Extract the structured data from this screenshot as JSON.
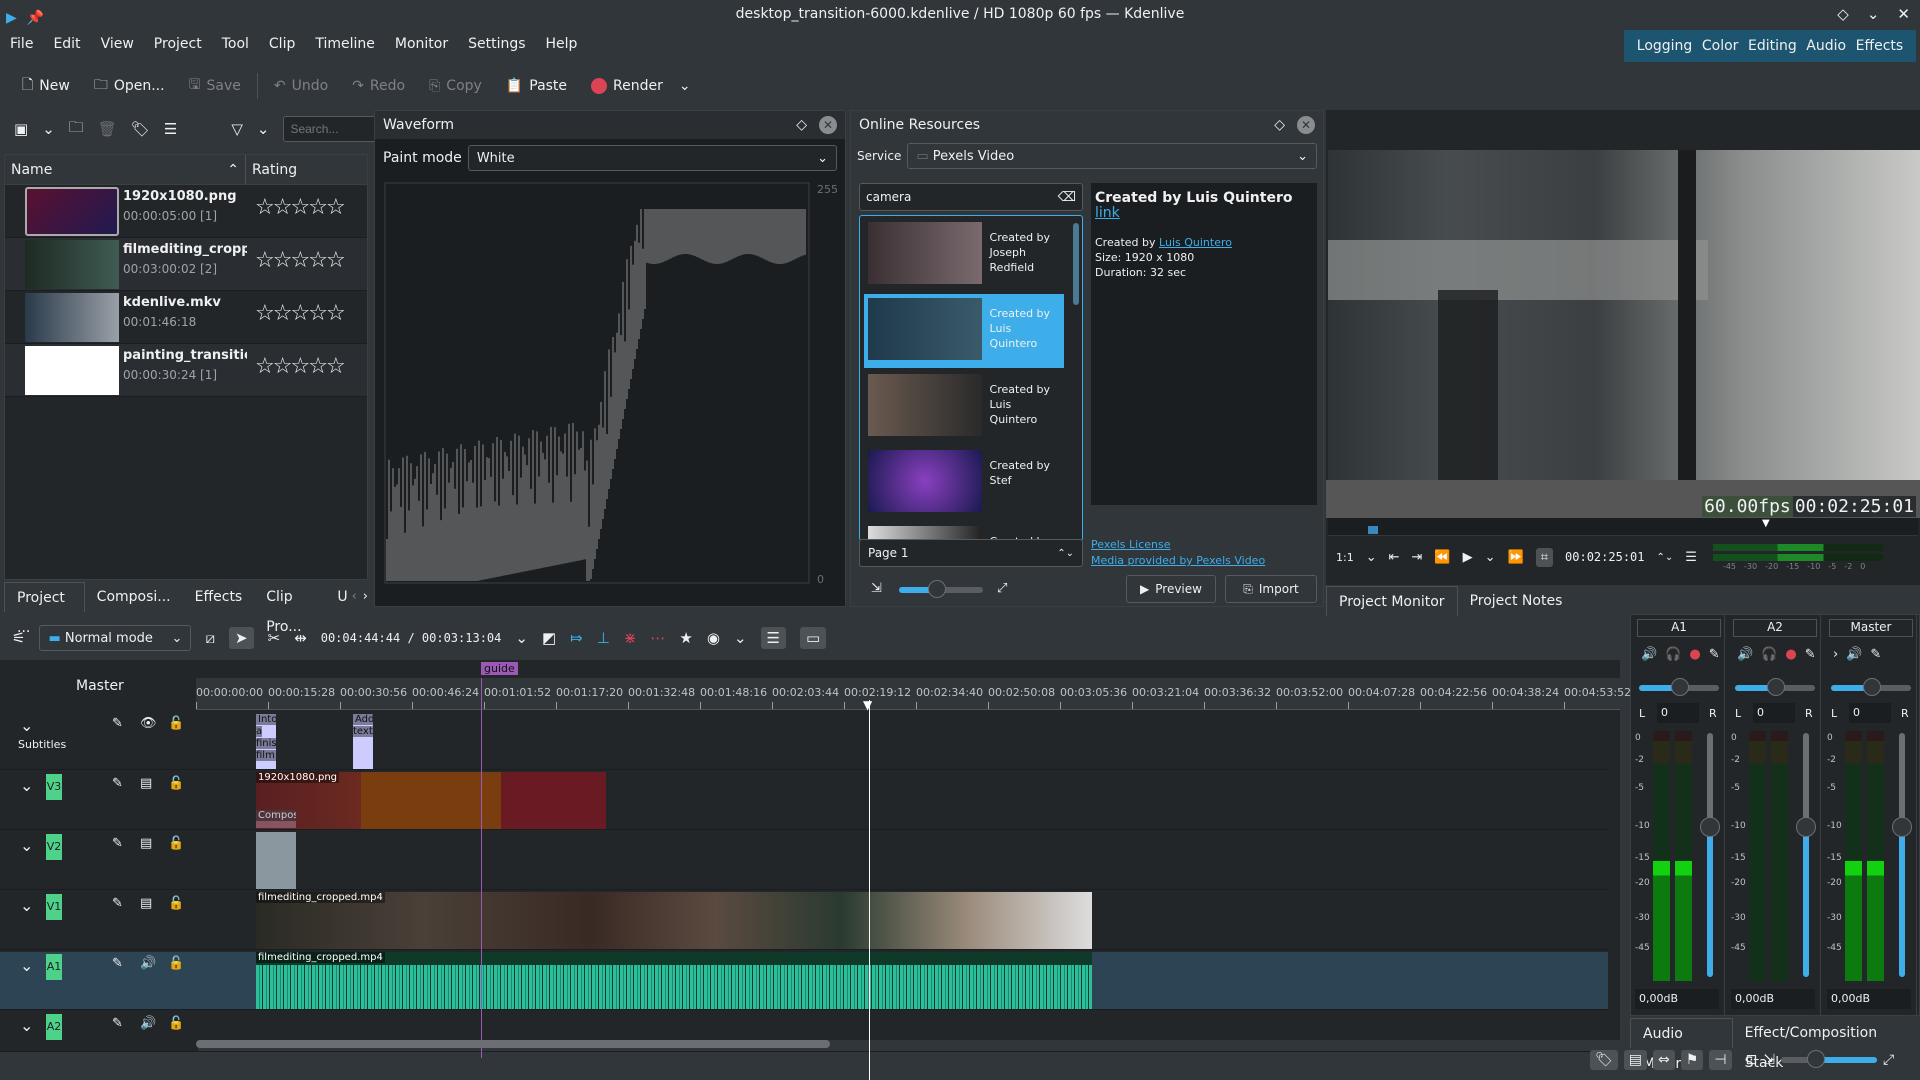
{
  "window": {
    "title": "desktop_transition-6000.kdenlive / HD 1080p 60 fps — Kdenlive"
  },
  "menu": [
    "File",
    "Edit",
    "View",
    "Project",
    "Tool",
    "Clip",
    "Timeline",
    "Monitor",
    "Settings",
    "Help"
  ],
  "workspaces": [
    "Logging",
    "Color",
    "Editing",
    "Audio",
    "Effects"
  ],
  "toolbar": {
    "new": "New",
    "open": "Open...",
    "save": "Save",
    "undo": "Undo",
    "redo": "Redo",
    "copy": "Copy",
    "paste": "Paste",
    "render": "Render"
  },
  "bin": {
    "search_placeholder": "Search...",
    "col_name": "Name",
    "col_rating": "Rating",
    "clips": [
      {
        "name": "1920x1080.png",
        "info": "00:00:05:00 [1]",
        "rating": 0
      },
      {
        "name": "filmediting_cropped.",
        "info": "00:03:00:02 [2]",
        "rating": 0
      },
      {
        "name": "kdenlive.mkv",
        "info": "00:01:46:18",
        "rating": 0
      },
      {
        "name": "painting_transition.r",
        "info": "00:00:30:24 [1]",
        "rating": 0
      }
    ],
    "tabs": [
      "Project ...",
      "Composi...",
      "Effects",
      "Clip Pro...",
      "U"
    ]
  },
  "waveform": {
    "title": "Waveform",
    "paint_mode_label": "Paint mode",
    "paint_mode": "White",
    "scale_max": "255",
    "scale_min": "0"
  },
  "online": {
    "title": "Online Resources",
    "service_label": "Service",
    "service": "Pexels Video",
    "query": "camera",
    "results": [
      {
        "label": "Created by Joseph Redfield"
      },
      {
        "label": "Created by Luis Quintero",
        "selected": true
      },
      {
        "label": "Created by Luis Quintero"
      },
      {
        "label": "Created by Stef"
      },
      {
        "label": "Created by"
      }
    ],
    "detail_title": "Created by Luis Quintero",
    "detail_link": "link",
    "detail_created": "Created by",
    "detail_author": "Luis Quintero",
    "detail_size": "Size: 1920 x 1080",
    "detail_duration": "Duration: 32 sec",
    "page": "Page 1",
    "license": "Pexels License",
    "provided": "Media provided by Pexels Video",
    "preview": "Preview",
    "import": "Import",
    "zoom_fraction": 0.45
  },
  "monitor": {
    "fps": "60.00fps",
    "timecode_overlay": "00:02:25:01",
    "zoom": "1:1",
    "timecode": "00:02:25:01",
    "vu_scale": [
      "-45",
      "-30",
      "-20",
      "-15",
      "-10",
      "-5",
      "-2",
      "0"
    ],
    "tabs": [
      "Project Monitor",
      "Project Notes"
    ]
  },
  "timeline_toolbar": {
    "mode": "Normal mode",
    "position": "00:04:44:44",
    "duration": "00:03:13:04"
  },
  "timeline": {
    "master": "Master",
    "guide": "guide",
    "ruler": [
      "00:00:00:00",
      "00:00:15:28",
      "00:00:30:56",
      "00:00:46:24",
      "00:01:01:52",
      "00:01:17:20",
      "00:01:32:48",
      "00:01:48:16",
      "00:02:03:44",
      "00:02:19:12",
      "00:02:34:40",
      "00:02:50:08",
      "00:03:05:36",
      "00:03:21:04",
      "00:03:36:32",
      "00:03:52:00",
      "00:04:07:28",
      "00:04:22:56",
      "00:04:38:24",
      "00:04:53:52"
    ],
    "tracks": [
      {
        "name": "Subtitles",
        "badge": ""
      },
      {
        "badge": "V3"
      },
      {
        "badge": "V2"
      },
      {
        "badge": "V1"
      },
      {
        "badge": "A1"
      },
      {
        "badge": "A2"
      }
    ],
    "clips": {
      "subtitle1": "Into a finished film",
      "subtitle2": "Add text",
      "v3": "1920x1080.png",
      "v3_comp": "Compos",
      "v1": "filmediting_cropped.mp4",
      "a1": "filmediting_cropped.mp4"
    }
  },
  "mixer": {
    "channels": [
      {
        "name": "A1",
        "gain": "0,00dB",
        "pan": "0"
      },
      {
        "name": "A2",
        "gain": "0,00dB",
        "pan": "0"
      },
      {
        "name": "Master",
        "gain": "0,00dB",
        "pan": "0"
      }
    ],
    "scale": [
      "0",
      "-2",
      "-5",
      "-10",
      "-15",
      "-20",
      "-30",
      "-45"
    ],
    "tabs": [
      "Audio Mixer",
      "Effect/Composition Stack"
    ]
  },
  "colors": {
    "accent": "#3daee9",
    "track_badge": "#4ed28a",
    "audio_clip": "#2bbf9b",
    "guide": "#9b59b6",
    "workspace_bar": "#1d546f"
  }
}
